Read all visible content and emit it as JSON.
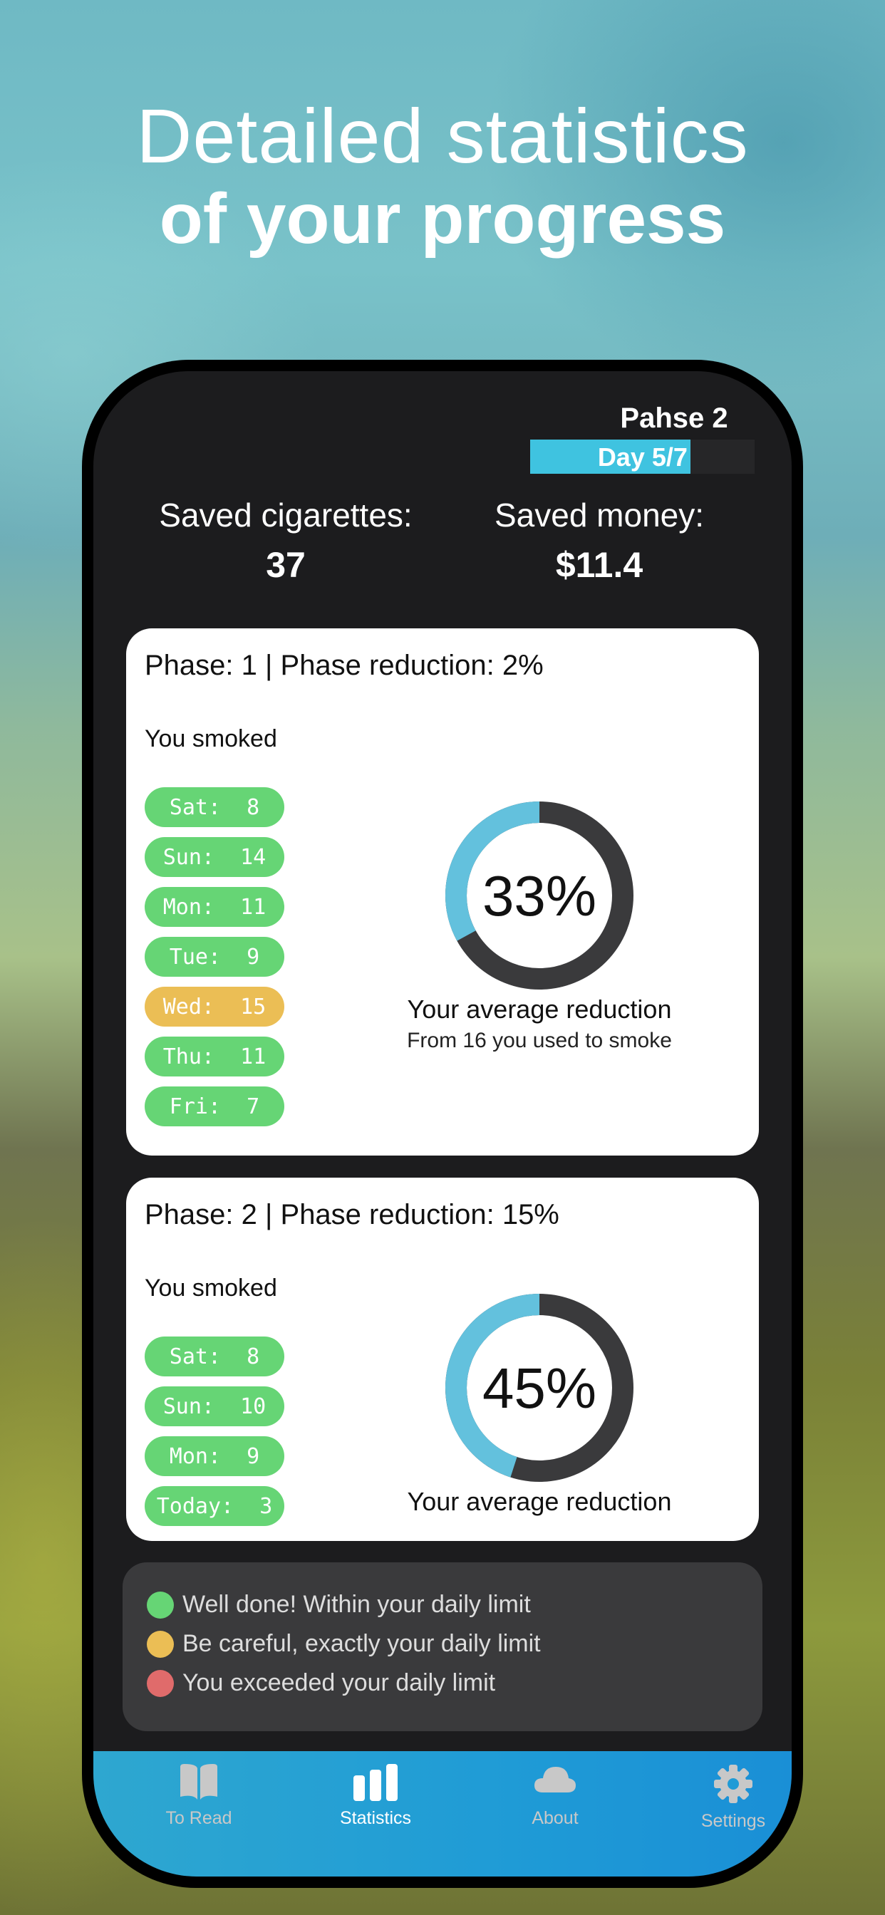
{
  "headline": {
    "line1": "Detailed statistics",
    "line2": "of your progress"
  },
  "header": {
    "phase_title": "Pahse 2",
    "day_label": "Day 5/7",
    "day_progress": 0.714
  },
  "stats": {
    "saved_cigarettes_label": "Saved cigarettes:",
    "saved_cigarettes_value": "37",
    "saved_money_label": "Saved money:",
    "saved_money_value": "$11.4"
  },
  "colors": {
    "within": "#66d575",
    "exact": "#ebbe55",
    "exceeded": "#e06b6b",
    "donut_fill": "#63c1dd",
    "donut_track": "#3a3a3c"
  },
  "phases": [
    {
      "title": "Phase: 1 | Phase reduction: 2%",
      "subtitle": "You smoked",
      "days": [
        {
          "label": "Sat:  8",
          "status": "within"
        },
        {
          "label": "Sun:  14",
          "status": "within"
        },
        {
          "label": "Mon:  11",
          "status": "within"
        },
        {
          "label": "Tue:  9",
          "status": "within"
        },
        {
          "label": "Wed:  15",
          "status": "exact"
        },
        {
          "label": "Thu:  11",
          "status": "within"
        },
        {
          "label": "Fri:  7",
          "status": "within"
        }
      ],
      "reduction_percent": 33,
      "reduction_text": "33%",
      "caption": "Your average reduction",
      "subcaption": "From 16 you used to smoke"
    },
    {
      "title": "Phase: 2 | Phase reduction: 15%",
      "subtitle": "You smoked",
      "days": [
        {
          "label": "Sat:  8",
          "status": "within"
        },
        {
          "label": "Sun:  10",
          "status": "within"
        },
        {
          "label": "Mon:  9",
          "status": "within"
        },
        {
          "label": "Today:  3",
          "status": "within"
        }
      ],
      "reduction_percent": 45,
      "reduction_text": "45%",
      "caption": "Your average reduction"
    }
  ],
  "legend": [
    {
      "status": "within",
      "text": "Well done! Within your daily limit"
    },
    {
      "status": "exact",
      "text": "Be careful, exactly your daily limit"
    },
    {
      "status": "exceeded",
      "text": "You exceeded your daily limit"
    }
  ],
  "tabs": [
    {
      "label": "To Read",
      "icon": "book-icon",
      "active": false
    },
    {
      "label": "Statistics",
      "icon": "bar-chart-icon",
      "active": true
    },
    {
      "label": "About",
      "icon": "cloud-icon",
      "active": false
    },
    {
      "label": "Settings",
      "icon": "gear-icon",
      "active": false
    }
  ]
}
